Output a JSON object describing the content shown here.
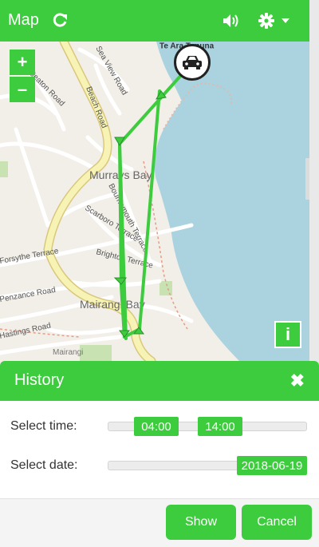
{
  "header": {
    "title": "Map",
    "refresh_icon": "refresh-icon",
    "sound_icon": "speaker-icon",
    "settings_icon": "gear-icon"
  },
  "map": {
    "zoom_in": "+",
    "zoom_out": "–",
    "info": "i",
    "labels": {
      "murrays_bay": "Murrays Bay",
      "mairangi_bay": "Mairangi Bay",
      "beach_road": "Beach Road",
      "scarboro_terrace": "Scarboro Terrace",
      "brighton_terrace": "Brighton Terrace",
      "bournemouth_terrace": "Bournemouth Terrace",
      "penzance_road": "Penzance Road",
      "forsythe_terrace": "Forsythe Terrace",
      "hastings_road": "Hastings Road",
      "sea_view_road": "Sea View Road",
      "seaton_road": "Seaton Road",
      "mairangi": "Mairangi",
      "top_label": "Te Ara Tupuna"
    },
    "route_color": "#3dcc3d",
    "water_color": "#aad3df"
  },
  "history": {
    "title": "History",
    "select_time_label": "Select time:",
    "time_start": "04:00",
    "time_end": "14:00",
    "select_date_label": "Select date:",
    "date_value": "2018-06-19",
    "show_button": "Show",
    "cancel_button": "Cancel"
  }
}
